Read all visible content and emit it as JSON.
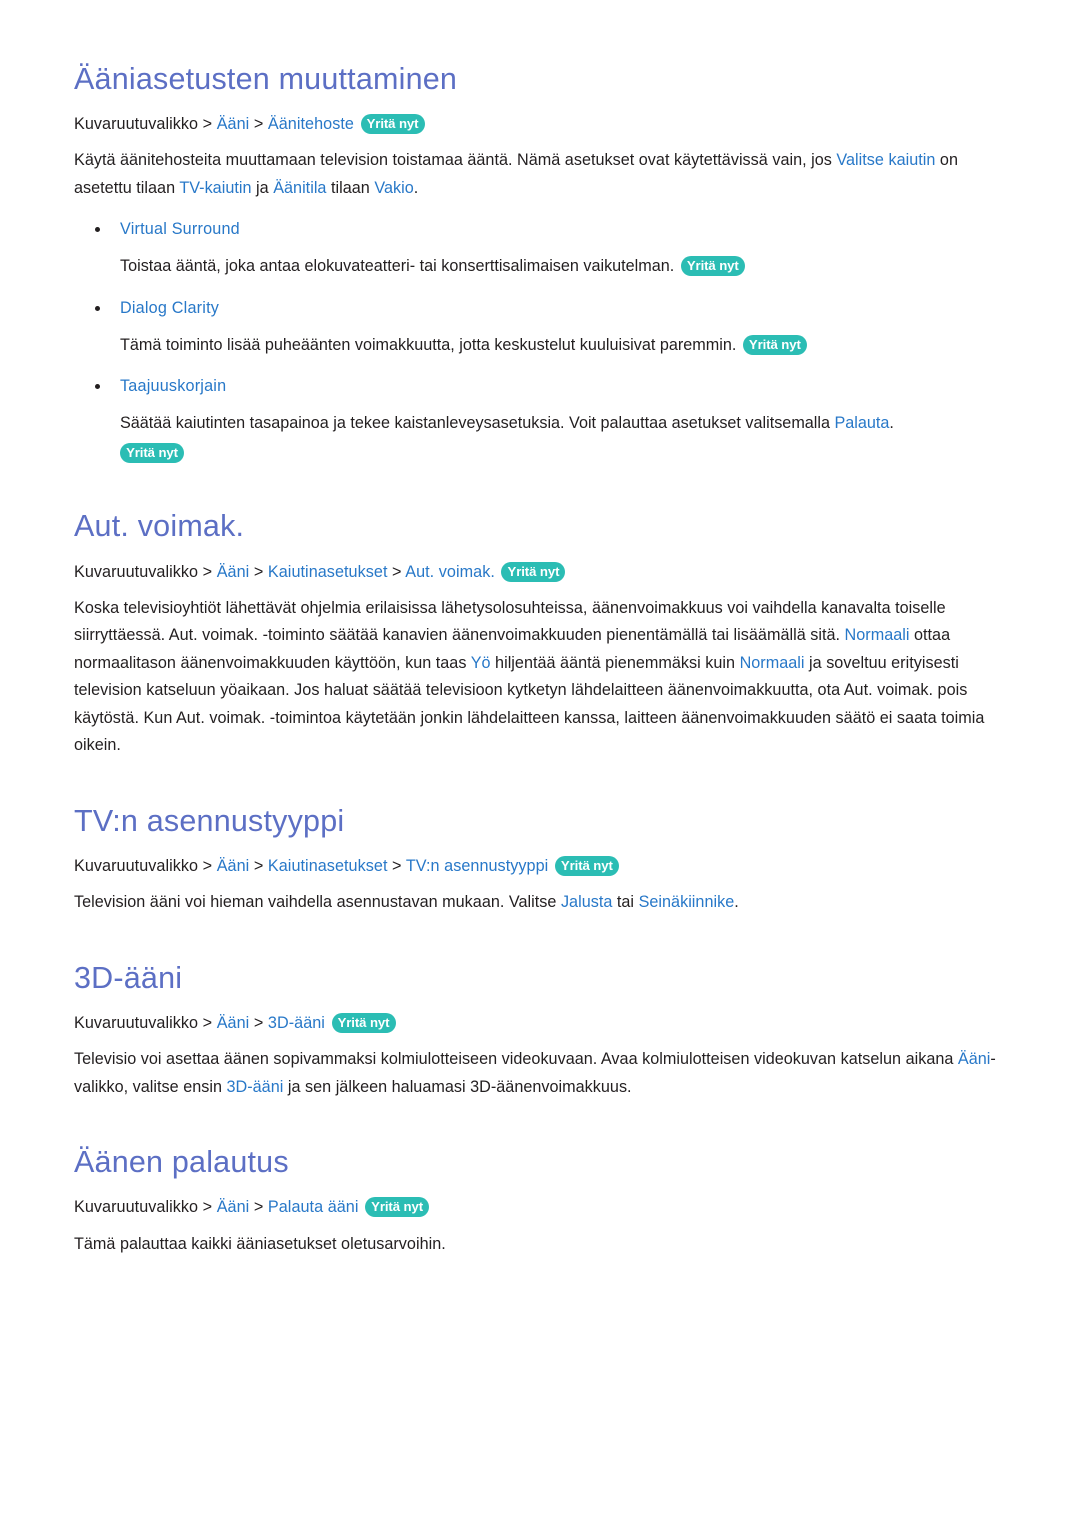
{
  "document": {
    "language": "fi",
    "colors": {
      "heading": "#5c6fc4",
      "link": "#2878c8",
      "body_text": "#231f20",
      "badge_background": "#2bbdb4",
      "badge_text": "#ffffff",
      "page_background": "#ffffff"
    },
    "breadcrumb_root": "Kuvaruutuvalikko",
    "breadcrumb_separator": ">",
    "try_now_label": "Yritä nyt"
  },
  "sections": [
    {
      "id": "sound-settings",
      "title": "Ääniasetusten muuttaminen",
      "breadcrumb": {
        "root": "Kuvaruutuvalikko",
        "sep1": ">",
        "item1": "Ääni",
        "sep2": ">",
        "item2": "Äänitehoste",
        "badge": "Yritä nyt"
      },
      "intro": {
        "part1": "Käytä äänitehosteita muuttamaan television toistamaa ääntä. Nämä asetukset ovat käytettävissä vain, jos ",
        "link1": "Valitse kaiutin",
        "part2": " on asetettu tilaan ",
        "link2": "TV-kaiutin",
        "part3": " ja ",
        "link3": "Äänitila",
        "part4": " tilaan ",
        "link4": "Vakio",
        "part5": "."
      },
      "bullets": [
        {
          "label": "Virtual Surround",
          "description": "Toistaa ääntä, joka antaa elokuvateatteri- tai konserttisalimaisen vaikutelman.",
          "badge": "Yritä nyt"
        },
        {
          "label": "Dialog Clarity",
          "description": "Tämä toiminto lisää puheäänten voimakkuutta, jotta keskustelut kuuluisivat paremmin.",
          "badge": "Yritä nyt"
        },
        {
          "label": "Taajuuskorjain",
          "description_part1": "Säätää kaiutinten tasapainoa ja tekee kaistanleveysasetuksia. Voit palauttaa asetukset valitsemalla ",
          "description_link": "Palauta",
          "description_part2": ".",
          "badge": "Yritä nyt"
        }
      ]
    },
    {
      "id": "auto-volume",
      "title": "Aut. voimak.",
      "breadcrumb": {
        "root": "Kuvaruutuvalikko",
        "sep1": ">",
        "item1": "Ääni",
        "sep2": ">",
        "item2": "Kaiutinasetukset",
        "sep3": ">",
        "item3": "Aut. voimak.",
        "badge": "Yritä nyt"
      },
      "body": {
        "part1": "Koska televisioyhtiöt lähettävät ohjelmia erilaisissa lähetysolosuhteissa, äänenvoimakkuus voi vaihdella kanavalta toiselle siirryttäessä. Aut. voimak. -toiminto säätää kanavien äänenvoimakkuuden pienentämällä tai lisäämällä sitä. ",
        "link1": "Normaali",
        "part2": " ottaa normaalitason äänenvoimakkuuden käyttöön, kun taas ",
        "link2": "Yö",
        "part3": " hiljentää ääntä pienemmäksi kuin ",
        "link3": "Normaali",
        "part4": " ja soveltuu erityisesti television katseluun yöaikaan. Jos haluat säätää televisioon kytketyn lähdelaitteen äänenvoimakkuutta, ota Aut. voimak. pois käytöstä. Kun Aut. voimak. -toimintoa käytetään jonkin lähdelaitteen kanssa, laitteen äänenvoimakkuuden säätö ei saata toimia oikein."
      }
    },
    {
      "id": "tv-installation-type",
      "title": "TV:n asennustyyppi",
      "breadcrumb": {
        "root": "Kuvaruutuvalikko",
        "sep1": ">",
        "item1": "Ääni",
        "sep2": ">",
        "item2": "Kaiutinasetukset",
        "sep3": ">",
        "item3": "TV:n asennustyyppi",
        "badge": "Yritä nyt"
      },
      "body": {
        "part1": "Television ääni voi hieman vaihdella asennustavan mukaan. Valitse ",
        "link1": "Jalusta",
        "part2": " tai ",
        "link2": "Seinäkiinnike",
        "part3": "."
      }
    },
    {
      "id": "3d-sound",
      "title": "3D-ääni",
      "breadcrumb": {
        "root": "Kuvaruutuvalikko",
        "sep1": ">",
        "item1": "Ääni",
        "sep2": ">",
        "item2": "3D-ääni",
        "badge": "Yritä nyt"
      },
      "body": {
        "part1": "Televisio voi asettaa äänen sopivammaksi kolmiulotteiseen videokuvaan. Avaa kolmiulotteisen videokuvan katselun aikana ",
        "link1": "Ääni",
        "part2": "-valikko, valitse ensin ",
        "link2": "3D-ääni",
        "part3": " ja sen jälkeen haluamasi 3D-äänenvoimakkuus."
      }
    },
    {
      "id": "sound-reset",
      "title": "Äänen palautus",
      "breadcrumb": {
        "root": "Kuvaruutuvalikko",
        "sep1": ">",
        "item1": "Ääni",
        "sep2": ">",
        "item2": "Palauta ääni",
        "badge": "Yritä nyt"
      },
      "body": {
        "part1": "Tämä palauttaa kaikki ääniasetukset oletusarvoihin."
      }
    }
  ]
}
